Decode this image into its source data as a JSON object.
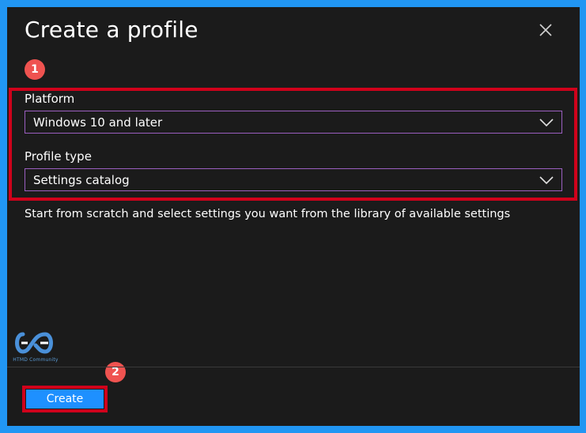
{
  "dialog": {
    "title": "Create a profile",
    "close_icon": "close-icon"
  },
  "annotations": {
    "badge_1": "1",
    "badge_2": "2",
    "highlight_color": "#d0021b",
    "badge_color": "#ef5350"
  },
  "platform": {
    "label": "Platform",
    "value": "Windows 10 and later",
    "icon": "chevron-down-icon"
  },
  "profile_type": {
    "label": "Profile type",
    "value": "Settings catalog",
    "icon": "chevron-down-icon"
  },
  "description": "Start from scratch and select settings you want from the library of available settings",
  "logo": {
    "text": "HTMD Community",
    "icon": "htmd-logo-icon"
  },
  "footer": {
    "create_label": "Create",
    "accent": "#1e90ff"
  },
  "colors": {
    "panel_background": "#1b1b1b",
    "page_background": "#2196f3",
    "dropdown_border": "#9b5fc0"
  }
}
